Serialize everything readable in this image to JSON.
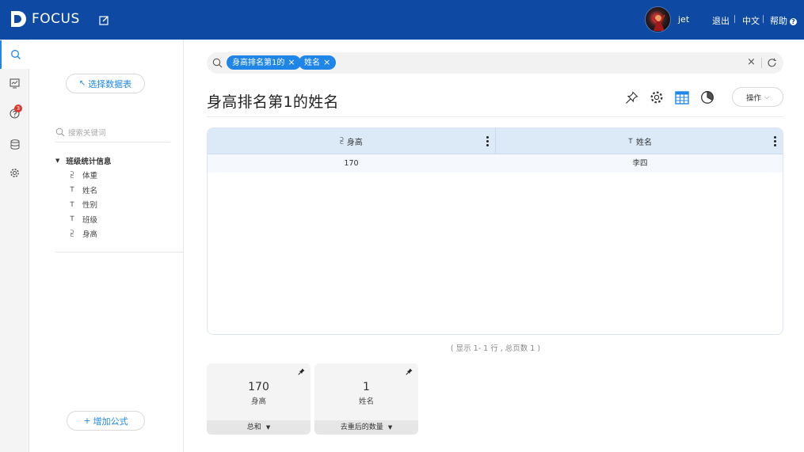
{
  "app": {
    "name": "FOCUS"
  },
  "header": {
    "username": "jet",
    "logout": "退出",
    "language": "中文",
    "help": "帮助",
    "help_badge": "?"
  },
  "rail": {
    "items": [
      {
        "icon": "search-icon",
        "active": true
      },
      {
        "icon": "dashboard-icon"
      },
      {
        "icon": "question-icon",
        "badge": "3"
      },
      {
        "icon": "database-icon"
      },
      {
        "icon": "settings-icon"
      }
    ]
  },
  "panel": {
    "select_data_button": "选择数据表",
    "search_placeholder": "搜索关键词",
    "table_name": "班级统计信息",
    "fields": [
      {
        "icon": "measure-icon",
        "glyph": "⫔",
        "label": "体重"
      },
      {
        "icon": "text-field-icon",
        "glyph": "⊤",
        "label": "姓名"
      },
      {
        "icon": "text-field-icon",
        "glyph": "⊤",
        "label": "性别"
      },
      {
        "icon": "text-field-icon",
        "glyph": "⊤",
        "label": "班级"
      },
      {
        "icon": "measure-icon",
        "glyph": "⫔",
        "label": "身高"
      }
    ],
    "add_formula_button": "增加公式"
  },
  "search": {
    "chips": [
      "身高排名第1的",
      "姓名"
    ]
  },
  "main": {
    "title": "身高排名第1的姓名",
    "operations_button": "操作"
  },
  "table": {
    "columns": [
      {
        "label": "身高",
        "glyph": "⫔"
      },
      {
        "label": "姓名",
        "glyph": "⊤"
      }
    ],
    "rows": [
      [
        "170",
        "李四"
      ]
    ],
    "pager": "( 显示 1- 1 行 , 总页数 1 )"
  },
  "cards": [
    {
      "value": "170",
      "label": "身高",
      "aggregation": "总和"
    },
    {
      "value": "1",
      "label": "姓名",
      "aggregation": "去重后的数量"
    }
  ],
  "colors": {
    "header_bg": "#0e4aa3",
    "accent": "#1f86e8",
    "table_header_bg": "#dceaf8",
    "badge": "#e0352b"
  }
}
